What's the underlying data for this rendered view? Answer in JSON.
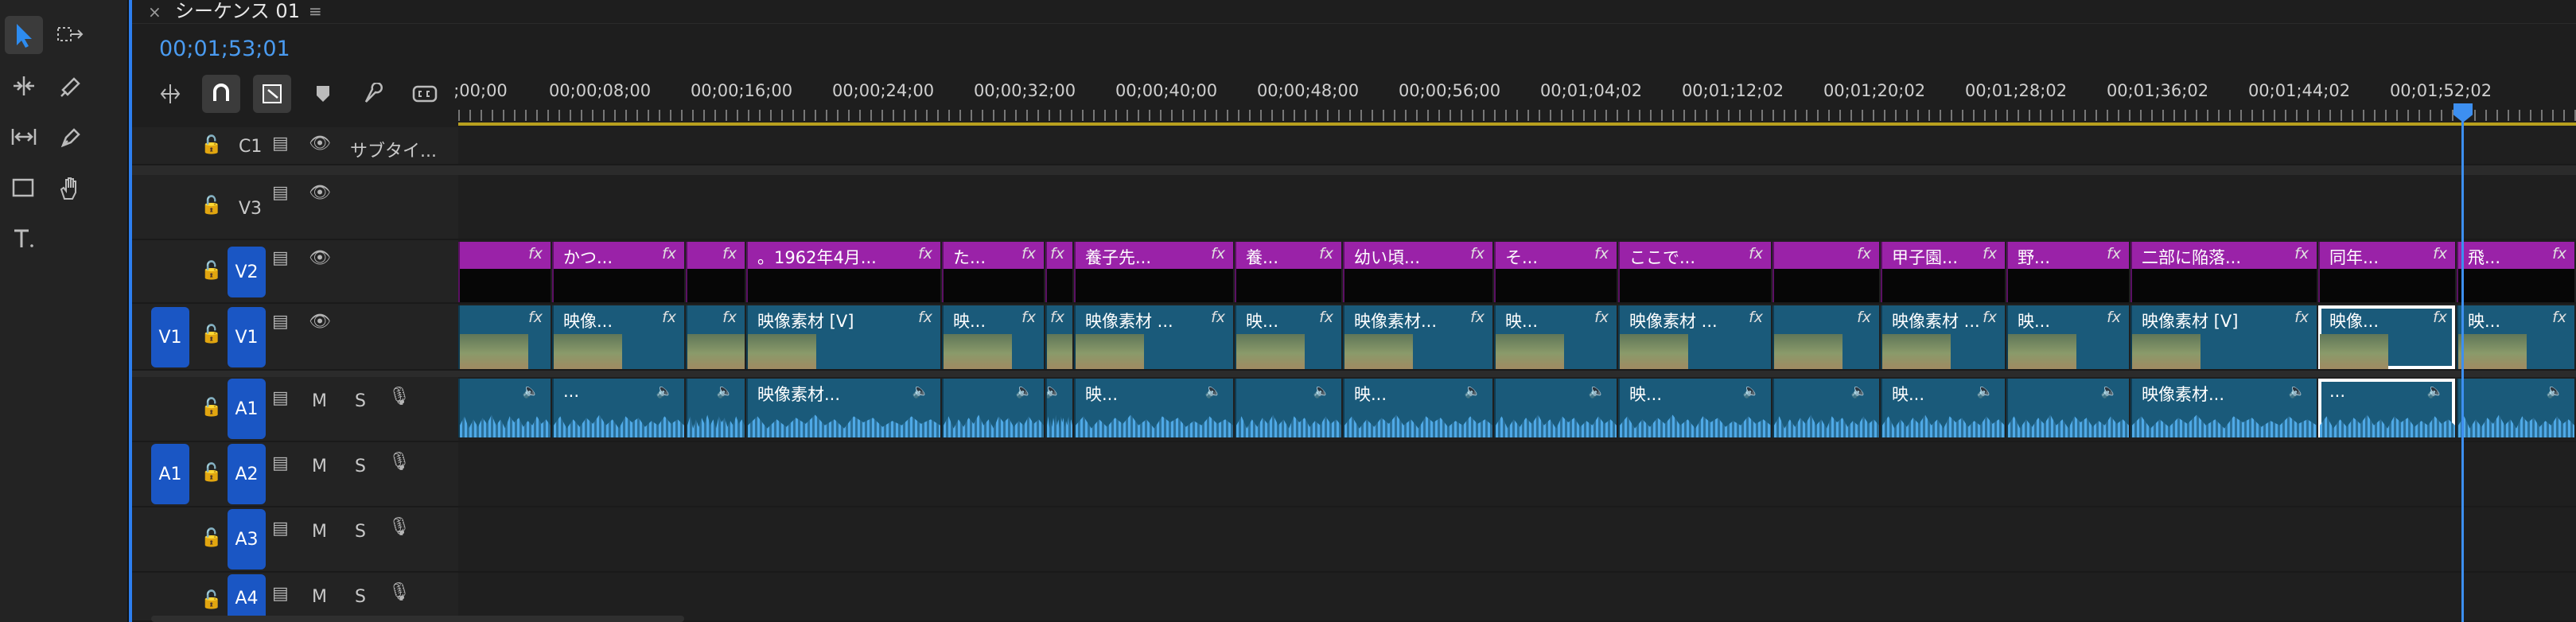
{
  "toolbar": {
    "tools": [
      {
        "name": "selection-tool-icon",
        "glyph": "➤"
      },
      {
        "name": "track-select-tool-icon",
        "glyph": "⇢"
      },
      {
        "name": "ripple-edit-tool-icon",
        "glyph": "⇹"
      },
      {
        "name": "razor-tool-icon",
        "glyph": "⧄"
      },
      {
        "name": "slip-tool-icon",
        "glyph": "↔"
      },
      {
        "name": "pen-tool-icon",
        "glyph": "✎"
      },
      {
        "name": "rectangle-tool-icon",
        "glyph": "▭"
      },
      {
        "name": "hand-tool-icon",
        "glyph": "✋"
      },
      {
        "name": "type-tool-icon",
        "glyph": "T"
      }
    ]
  },
  "panel": {
    "close": "×",
    "title": "シーケンス 01",
    "menu": "≡",
    "timecode": "00;01;53;01"
  },
  "ruler": {
    "labels": [
      ";00;00",
      "00;00;08;00",
      "00;00;16;00",
      "00;00;24;00",
      "00;00;32;00",
      "00;00;40;00",
      "00;00;48;00",
      "00;00;56;00",
      "00;01;04;02",
      "00;01;12;02",
      "00;01;20;02",
      "00;01;28;02",
      "00;01;36;02",
      "00;01;44;02",
      "00;01;52;02"
    ]
  },
  "tracks": {
    "c1": {
      "name": "C1",
      "label": "サブタイ..."
    },
    "v3": {
      "name": "V3"
    },
    "v2": {
      "name": "V2"
    },
    "v1": {
      "name": "V1",
      "source": "V1"
    },
    "a1": {
      "name": "A1",
      "m": "M",
      "s": "S"
    },
    "a2": {
      "name": "A2",
      "source": "A1",
      "m": "M",
      "s": "S"
    },
    "a3": {
      "name": "A3",
      "m": "M",
      "s": "S"
    },
    "a4": {
      "name": "A4",
      "m": "M",
      "s": "S"
    }
  },
  "v2_clips": [
    "",
    "かつ...",
    "",
    "。1962年4月...",
    "た...",
    "",
    "養子先...",
    "養...",
    "幼い頃...",
    "そ...",
    "ここで...",
    "",
    "甲子園...",
    "野...",
    "二部に陥落...",
    "同年...",
    "飛..."
  ],
  "v1_clips": [
    "",
    "映像...",
    "",
    "映像素材 [V]",
    "映...",
    "",
    "映像素材 ...",
    "映...",
    "映像素材...",
    "映...",
    "映像素材 ...",
    "",
    "映像素材 ...",
    "映...",
    "映像素材 [V]",
    "映像...",
    "映..."
  ],
  "a1_clips": [
    "",
    "...",
    "",
    "映像素材...",
    "",
    "",
    "映...",
    "",
    "映...",
    "",
    "映...",
    "",
    "映...",
    "",
    "映像素材...",
    "...",
    ""
  ],
  "fx": "fx",
  "speaker": "🔈"
}
